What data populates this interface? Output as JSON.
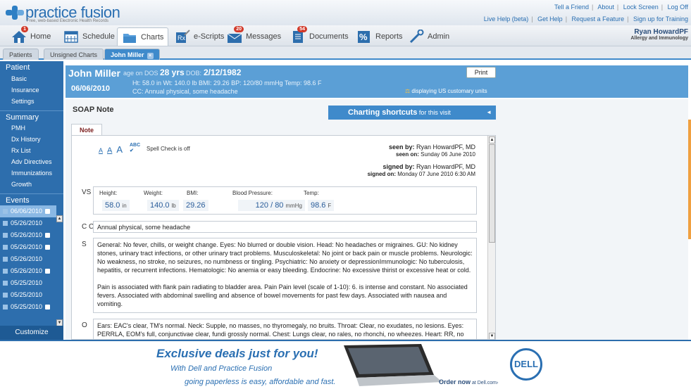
{
  "app": {
    "logo_text": "practice fusion",
    "logo_tagline": "Free, web-based Electronic Health Records"
  },
  "top_links_row1": [
    "Tell a Friend",
    "About",
    "Lock Screen",
    "Log Off"
  ],
  "top_links_row2": [
    "Live Help (beta)",
    "Get Help",
    "Request a Feature",
    "Sign up for Training"
  ],
  "user": {
    "name": "Ryan HowardPF",
    "specialty": "Allergy and Immunology"
  },
  "nav": {
    "home": "Home",
    "schedule": "Schedule",
    "charts": "Charts",
    "escripts": "e-Scripts",
    "messages": "Messages",
    "documents": "Documents",
    "reports": "Reports",
    "admin": "Admin",
    "home_badge": "1",
    "messages_badge": "20",
    "documents_badge": "54"
  },
  "tabs": {
    "patients": "Patients",
    "unsigned": "Unsigned Charts",
    "patient": "John Miller",
    "close": "×"
  },
  "sidebar": {
    "patient_head": "Patient",
    "patient_items": [
      "Basic",
      "Insurance",
      "Settings"
    ],
    "summary_head": "Summary",
    "summary_items": [
      "PMH",
      "Dx History",
      "Rx List",
      "Adv Directives",
      "Immunizations",
      "Growth"
    ],
    "events_head": "Events",
    "events": [
      "06/06/2010",
      "05/26/2010",
      "05/26/2010",
      "05/26/2010",
      "05/26/2010",
      "05/26/2010",
      "05/25/2010",
      "05/25/2010",
      "05/25/2010"
    ],
    "customize": "Customize"
  },
  "header": {
    "name": "John Miller",
    "age_label": "age on DOS",
    "age": "28 yrs",
    "dob_label": "DOB:",
    "dob": "2/12/1982",
    "date": "06/06/2010",
    "vitals": "Ht: 58.0 in   Wt: 140.0 lb   BMI: 29.26   BP: 120/80 mmHg   Temp: 98.6 F",
    "cc": "CC: Annual physical, some headache",
    "units": "displaying US customary units",
    "print": "Print"
  },
  "soap": {
    "title": "SOAP Note",
    "shortcuts": "Charting shortcuts",
    "shortcuts_sub": " for this visit",
    "note_tab": "Note",
    "font_sizes": [
      "A",
      "A",
      "A"
    ],
    "spell": "Spell Check is off",
    "spell_icon": "ABC",
    "seen_by_label": "seen by:",
    "seen_by": "Ryan HowardPF, MD",
    "seen_on_label": "seen on:",
    "seen_on": "Sunday 06 June 2010",
    "signed_by_label": "signed by:",
    "signed_by": "Ryan HowardPF, MD",
    "signed_on_label": "signed on:",
    "signed_on": "Monday 07 June 2010 6:30 AM",
    "vs_label": "VS",
    "vs": {
      "height_label": "Height:",
      "height": "58.0",
      "height_unit": "in",
      "weight_label": "Weight:",
      "weight": "140.0",
      "weight_unit": "lb",
      "bmi_label": "BMI:",
      "bmi": "29.26",
      "bp_label": "Blood Pressure:",
      "bp": "120 / 80",
      "bp_unit": "mmHg",
      "temp_label": "Temp:",
      "temp": "98.6",
      "temp_unit": "F"
    },
    "cc_label": "C C",
    "cc_text": "Annual physical, some headache",
    "s_label": "S",
    "s_text1": "General: No fever, chills, or weight change.  Eyes: No blurred or double vision.  Head: No headaches or migraines.  GU: No kidney stones, urinary tract infections, or other urinary tract problems.  Musculoskeletal: No joint or back pain or muscle problems.  Neurologic: No weakness, no stroke, no seizures, no numbness or tingling.  Psychiatric: No anxiety or depressionImmunologic: No tuberculosis, hepatitis, or recurrent infections.  Hematologic: No anemia or easy bleeding.  Endocrine: No excessive thirist or excessive heat or cold.",
    "s_text2": "Pain is associated with flank pain radiating to bladder area.  Pain Pain level (scale of 1-10): 6.  is intense and constant.  No associated fevers.  Associated with abdominal swelling and absence of bowel movements for past few days.  Associated with nausea and vomiting.",
    "o_label": "O",
    "o_text": "Ears: EAC's clear, TM's normal.  Neck: Supple, no masses, no thyromegaly, no bruits.  Throat: Clear, no exudates, no lesions.  Eyes: PERRLA, EOM's full, conjunctivae clear, fundi grossly normal.  Chest: Lungs clear, no rales, no rhonchi, no wheezes.  Heart: RR, no murmurs, no rubs, no gallops.  Abdomen: Soft, no tenderness, no masses, BS normal.  GU: Normal, no lesions, no"
  },
  "ad": {
    "headline": "Exclusive deals just for you!",
    "line1": "With Dell and Practice Fusion",
    "line2": "going paperless is easy, affordable and fast.",
    "brand": "DELL",
    "order": "Order now",
    "order_sub": " at Dell.com›"
  },
  "colors": {
    "brand_blue": "#2a6fb2",
    "sidebar": "#2d6ead",
    "header": "#5b9fd6",
    "badge": "#d23a2a"
  }
}
